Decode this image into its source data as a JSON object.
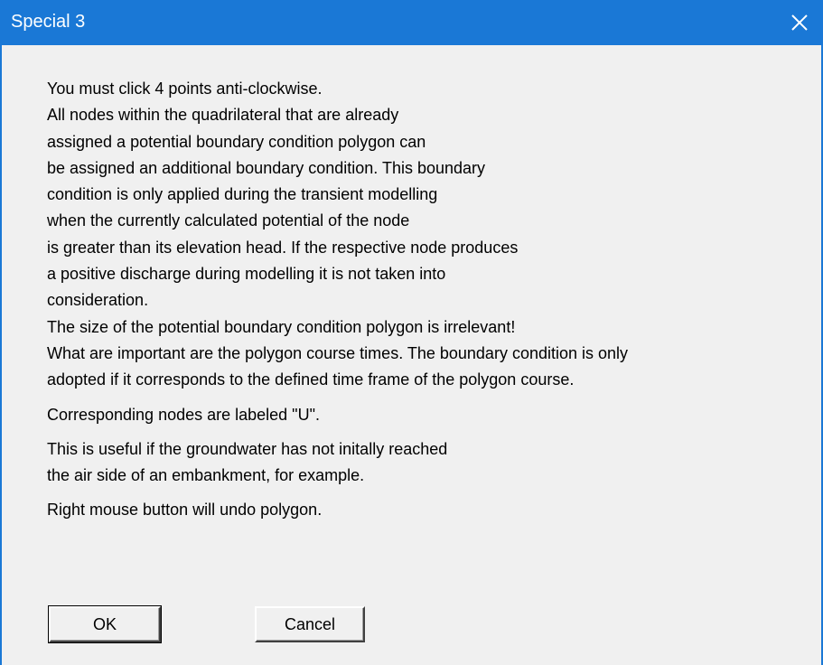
{
  "window": {
    "title": "Special 3"
  },
  "message": {
    "paragraph1": [
      "You must click 4 points anti-clockwise.",
      "All nodes within the quadrilateral that are already",
      "assigned a potential boundary condition polygon can",
      "be assigned an additional boundary condition. This boundary",
      "condition is only applied during the transient modelling",
      "when the currently calculated potential of the node",
      "is greater than its elevation head. If the respective node produces",
      "a positive discharge during modelling it is not taken into",
      "consideration.",
      "The size of the potential boundary condition polygon is irrelevant!",
      "What are important are the polygon course times. The boundary condition is only",
      "adopted if it corresponds to the defined time frame of the polygon course."
    ],
    "paragraph2": "Corresponding nodes are labeled \"U\".",
    "paragraph3": [
      "This is useful if the groundwater has not initally reached",
      "the air side of an embankment, for example."
    ],
    "paragraph4": "Right mouse button will undo polygon."
  },
  "buttons": {
    "ok": "OK",
    "cancel": "Cancel"
  },
  "colors": {
    "titlebar": "#1a78d6",
    "dialog_bg": "#f0f0f0"
  },
  "icons": {
    "close": "close-icon"
  }
}
